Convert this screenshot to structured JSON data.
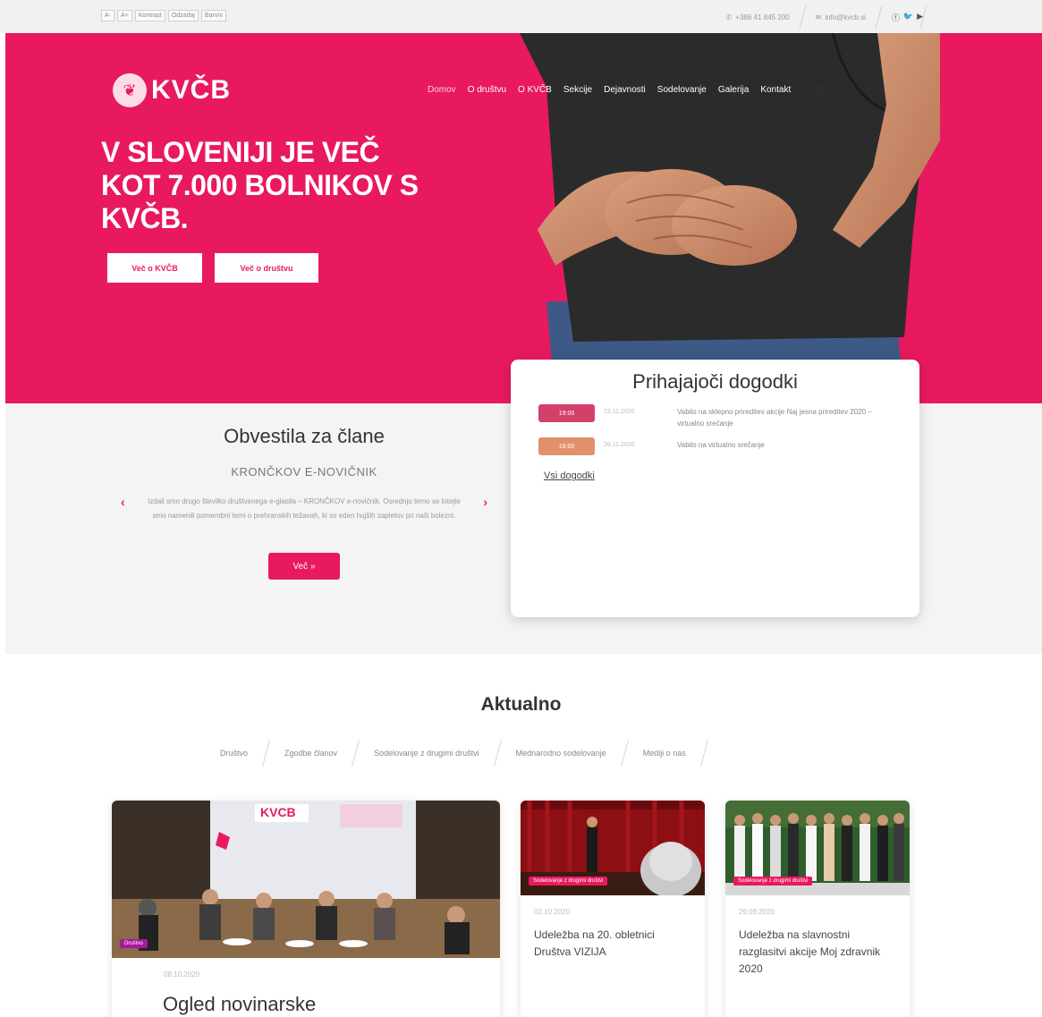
{
  "topbar": {
    "languages": [
      "A-",
      "A+",
      "Kontrast",
      "Odzadaj",
      "Barvni"
    ],
    "phone": "+386 41 845 200",
    "email": "info@kvcb.si",
    "social_icons": [
      "facebook-icon",
      "twitter-icon",
      "youtube-icon"
    ]
  },
  "brand": {
    "logo_text": "KVČB",
    "accent": "#e8195f"
  },
  "nav": {
    "items": [
      "Domov",
      "O društvu",
      "O KVČB",
      "Sekcije",
      "Dejavnosti",
      "Sodelovanje",
      "Galerija",
      "Kontakt"
    ],
    "active": "Domov"
  },
  "hero": {
    "title": "V SLOVENIJI JE VEČ KOT 7.000 BOLNIKOV S KVČB.",
    "btn1": "Več o KVČB",
    "btn2": "Več o društvu"
  },
  "notices": {
    "title": "Obvestila za člane",
    "subtitle": "KRONČKOV E-NOVIČNIK",
    "body": "Izdali smo drugo številko društvenega e-glasila – KRONČKOV e-novičnik. Osrednjo temo se lotejte smo namenili pomembni temi o prehranskih težavah, ki so eden hujših zapletov pri naši bolezni.",
    "more": "Več »"
  },
  "events": {
    "title": "Prihajajoči dogodki",
    "items": [
      {
        "tag": "19:00",
        "date": "22.11.2020",
        "desc": "Vabilo na sklepno prireditev akcije Naj jesna prireditev 2020 – virtualno srečanje",
        "color": "#d3406a"
      },
      {
        "tag": "18:00",
        "date": "26.11.2020",
        "desc": "Vabilo na virtualno srečanje",
        "color": "#e2906c"
      }
    ],
    "all_link": "Vsi dogodki"
  },
  "aktualno": {
    "title": "Aktualno",
    "filters": [
      "Društvo",
      "Zgodbe članov",
      "Sodelovanje z drugimi društvi",
      "Mednarodno sodelovanje",
      "Mediji o nas"
    ],
    "cards": [
      {
        "badge": "Društvo",
        "date": "08.10.2020",
        "title": "Ogled novinarske",
        "big": true
      },
      {
        "badge": "Sodelovanje z drugimi društvi",
        "date": "02.10.2020",
        "title": "Udeležba na 20. obletnici Društva VIZIJA"
      },
      {
        "badge": "Sodelovanje z drugimi društvi",
        "date": "29.09.2020",
        "title": "Udeležba na slavnostni razglasitvi akcije Moj zdravnik 2020"
      }
    ]
  }
}
